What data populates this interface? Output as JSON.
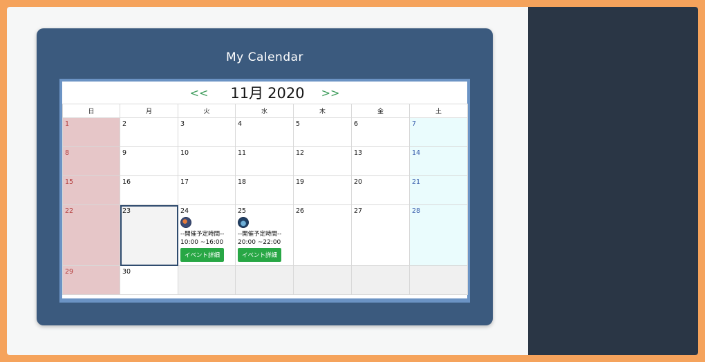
{
  "title": "My Calendar",
  "nav": {
    "prev": "<<",
    "next": ">>"
  },
  "month": {
    "label": "11月",
    "year": "2020"
  },
  "weekdays": [
    "日",
    "月",
    "火",
    "水",
    "木",
    "金",
    "土"
  ],
  "days": {
    "d1": "1",
    "d2": "2",
    "d3": "3",
    "d4": "4",
    "d5": "5",
    "d6": "6",
    "d7": "7",
    "d8": "8",
    "d9": "9",
    "d10": "10",
    "d11": "11",
    "d12": "12",
    "d13": "13",
    "d14": "14",
    "d15": "15",
    "d16": "16",
    "d17": "17",
    "d18": "18",
    "d19": "19",
    "d20": "20",
    "d21": "21",
    "d22": "22",
    "d23": "23",
    "d24": "24",
    "d25": "25",
    "d26": "26",
    "d27": "27",
    "d28": "28",
    "d29": "29",
    "d30": "30"
  },
  "events": [
    {
      "day": "24",
      "label": "--開催予定時間--",
      "time": "10:00 ~16:00",
      "button": "イベント詳細",
      "avatar": "avatar-icon"
    },
    {
      "day": "25",
      "label": "--開催予定時間--",
      "time": "20:00 ~22:00",
      "button": "イベント詳細",
      "avatar": "avatar-icon"
    }
  ],
  "colors": {
    "card": "#3b5a7e",
    "sidebar": "#2a3645",
    "border": "#f5a35c",
    "sunday": "#e6c6c8",
    "saturday": "#eafcfd",
    "button": "#28a745",
    "nav": "#3a9a58"
  }
}
